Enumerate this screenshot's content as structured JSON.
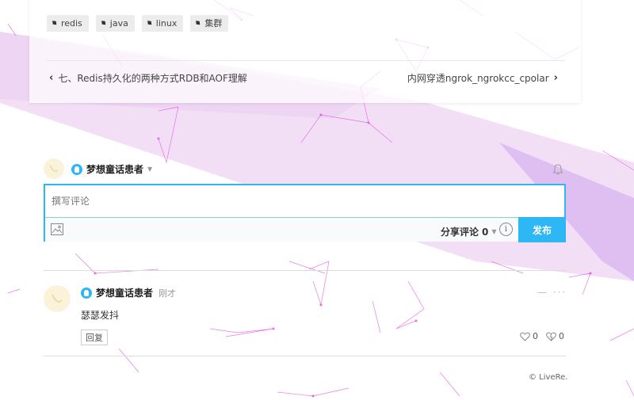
{
  "tags": [
    {
      "label": "redis",
      "icon": "tag-icon"
    },
    {
      "label": "java",
      "icon": "tag-icon"
    },
    {
      "label": "linux",
      "icon": "tag-icon"
    },
    {
      "label": "集群",
      "icon": "tag-icon"
    }
  ],
  "post_nav": {
    "prev_label": "七、Redis持久化的两种方式RDB和AOF理解",
    "next_label": "内网穿透ngrok_ngrokcc_cpolar"
  },
  "composer": {
    "username": "梦想童话患者",
    "placeholder": "撰写评论",
    "share_label": "分享评论",
    "share_count": "0",
    "info_label": "i",
    "publish_label": "发布"
  },
  "comment": {
    "username": "梦想童话患者",
    "time": "刚才",
    "text": "瑟瑟发抖",
    "reply_label": "回复",
    "likes": "0",
    "dislikes": "0",
    "menu": "— ···"
  },
  "footer": {
    "brand": "© LiveRe."
  },
  "colors": {
    "accent": "#2db7f5",
    "band": "#efd6f3",
    "band_dark": "#d9b3ef",
    "lines": "#e24fe6"
  }
}
